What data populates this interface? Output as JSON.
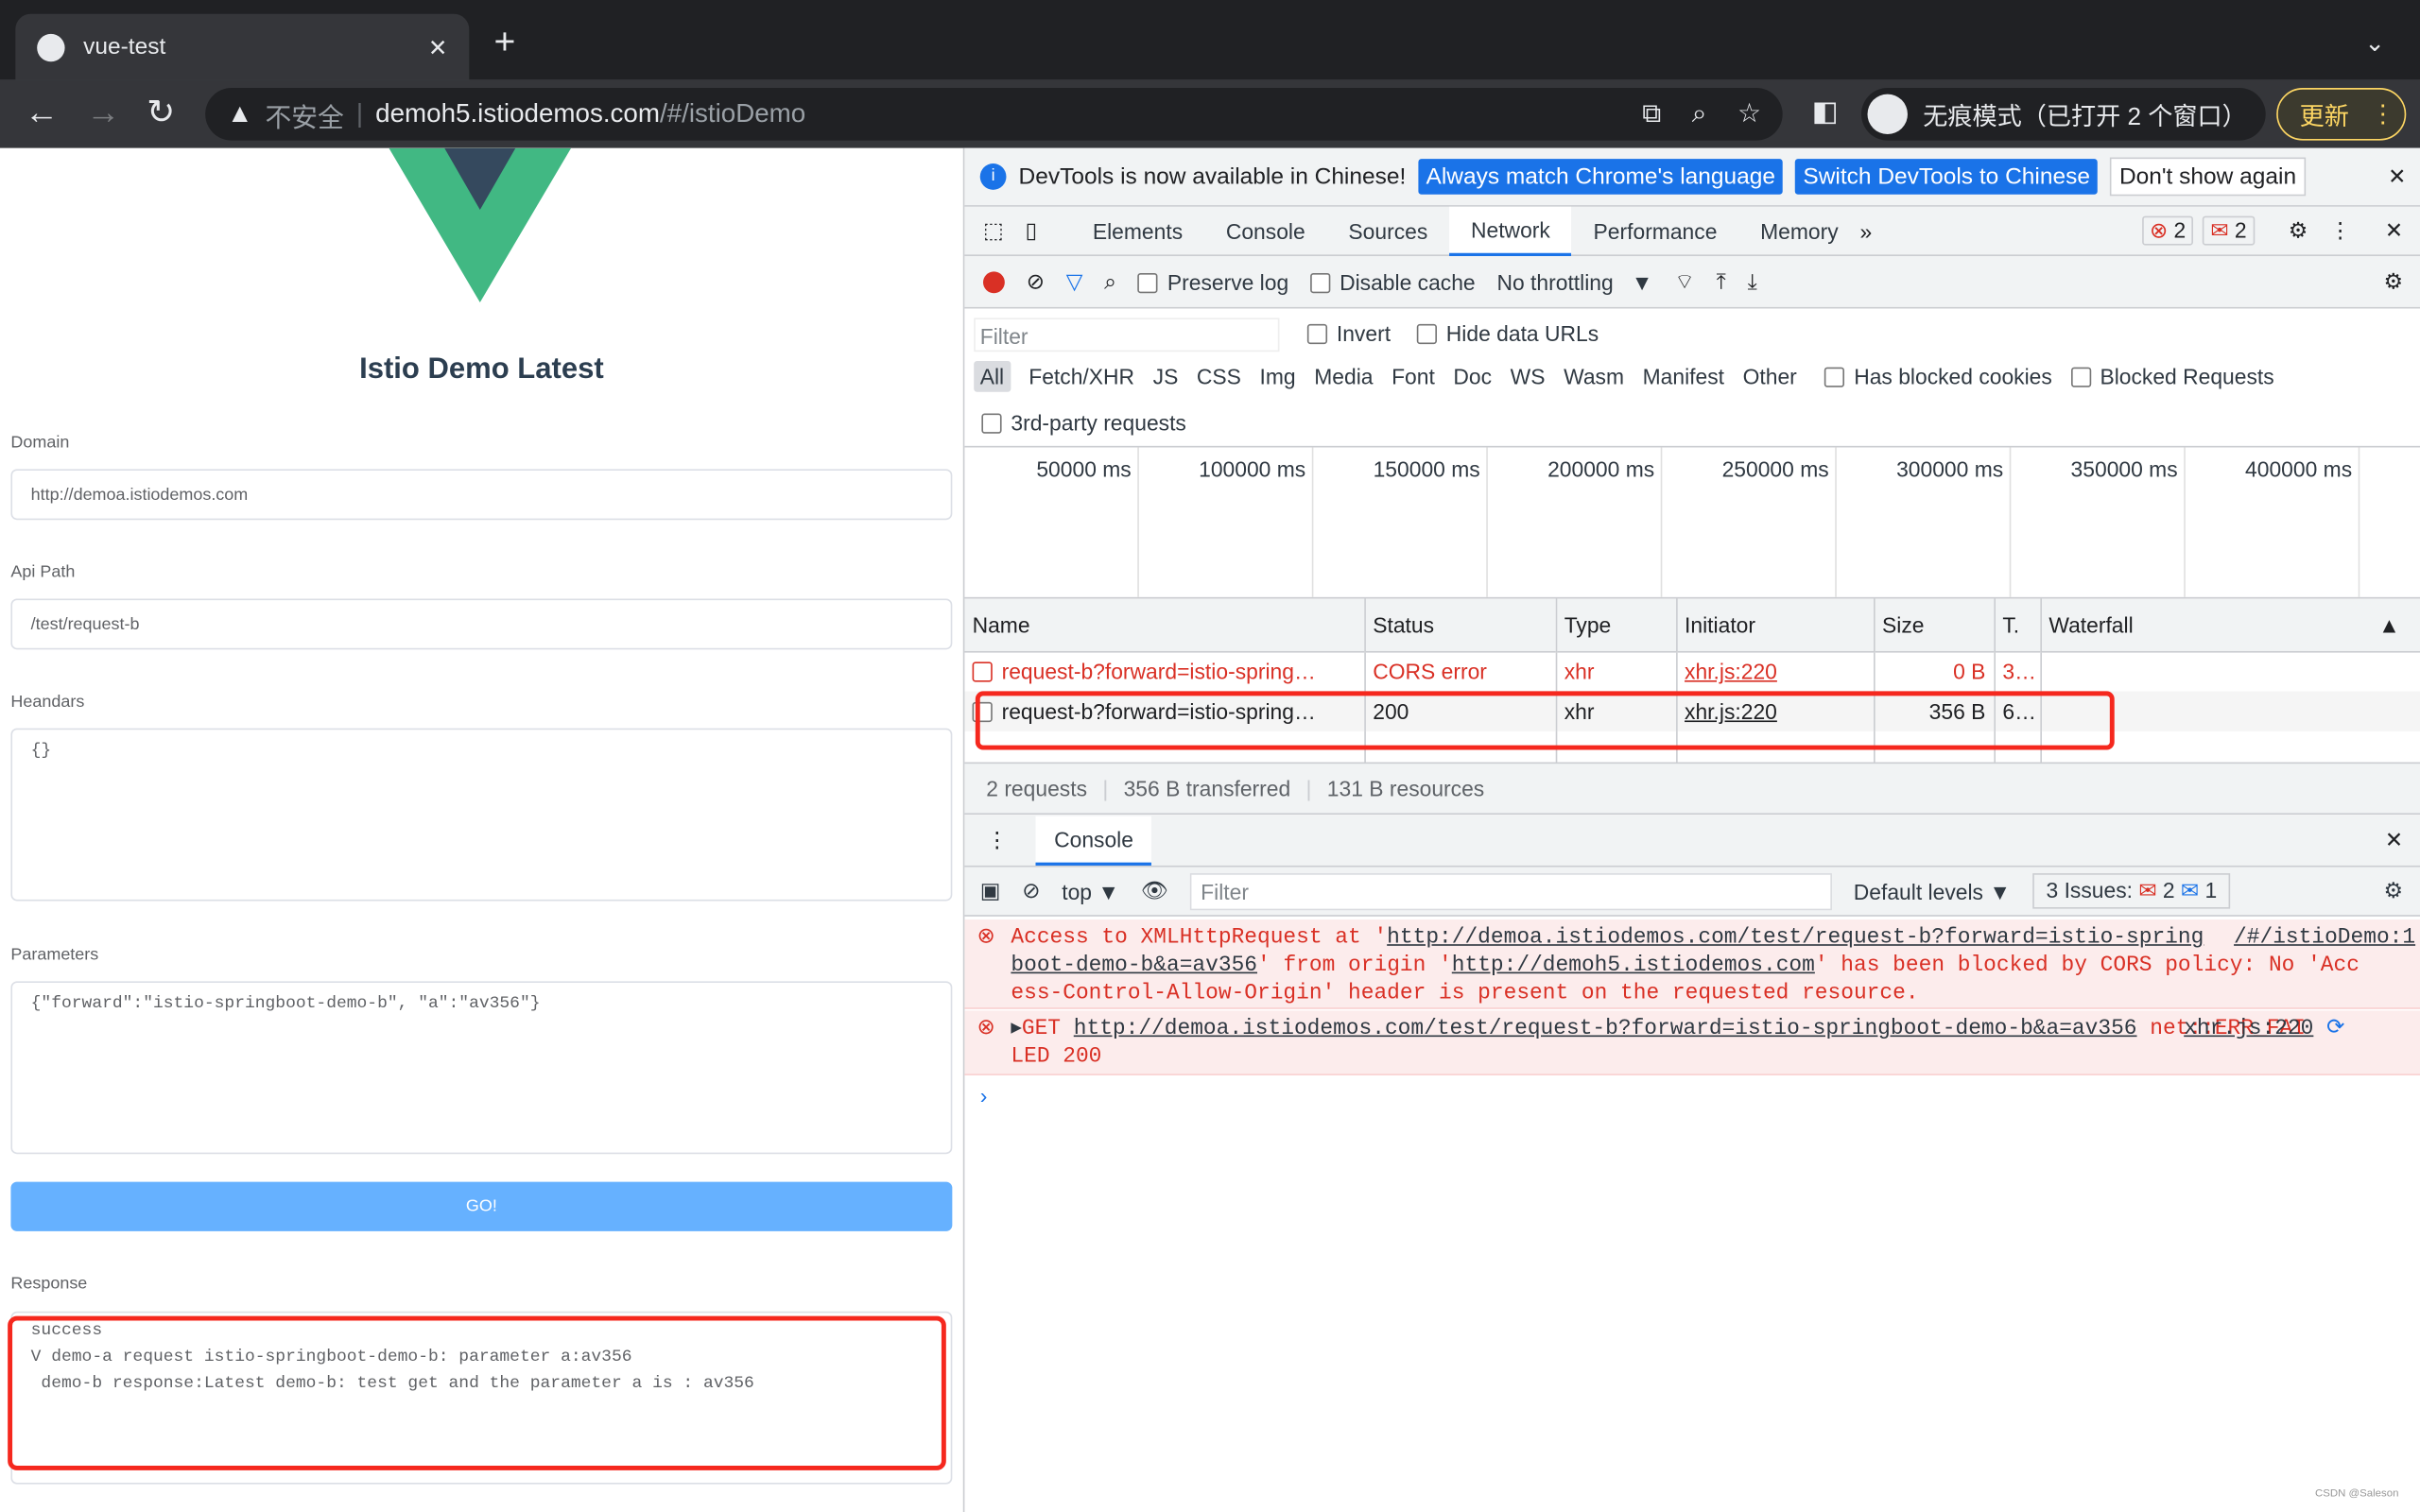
{
  "browser": {
    "tab_title": "vue-test",
    "security": "不安全",
    "url_host": "demoh5.istiodemos.com",
    "url_path": "/#/istioDemo",
    "incognito": "无痕模式（已打开 2 个窗口）",
    "update": "更新"
  },
  "app": {
    "title": "Istio Demo Latest",
    "domain_label": "Domain",
    "domain_value": "http://demoa.istiodemos.com",
    "path_label": "Api Path",
    "path_value": "/test/request-b",
    "headers_label": "Heandars",
    "headers_value": "{}",
    "params_label": "Parameters",
    "params_value": "{\"forward\":\"istio-springboot-demo-b\", \"a\":\"av356\"}",
    "go": "GO!",
    "response_label": "Response",
    "response_lines": [
      "success",
      "V demo-a request istio-springboot-demo-b: parameter a:av356",
      " demo-b response:Latest demo-b: test get and the parameter a is : av356"
    ]
  },
  "devtools": {
    "banner": {
      "text": "DevTools is now available in Chinese!",
      "match": "Always match Chrome's language",
      "switch": "Switch DevTools to Chinese",
      "dont": "Don't show again"
    },
    "tabs": [
      "Elements",
      "Console",
      "Sources",
      "Network",
      "Performance",
      "Memory"
    ],
    "active_tab": "Network",
    "errors": "2",
    "warnings": "2",
    "toolbar": {
      "preserve": "Preserve log",
      "cache": "Disable cache",
      "throttle": "No throttling"
    },
    "filter": {
      "placeholder": "Filter",
      "invert": "Invert",
      "hide": "Hide data URLs"
    },
    "types": [
      "All",
      "Fetch/XHR",
      "JS",
      "CSS",
      "Img",
      "Media",
      "Font",
      "Doc",
      "WS",
      "Wasm",
      "Manifest",
      "Other"
    ],
    "blocked_cookies": "Has blocked cookies",
    "blocked_req": "Blocked Requests",
    "third": "3rd-party requests",
    "timeline": [
      "50000 ms",
      "100000 ms",
      "150000 ms",
      "200000 ms",
      "250000 ms",
      "300000 ms",
      "350000 ms",
      "400000 ms"
    ],
    "columns": [
      "Name",
      "Status",
      "Type",
      "Initiator",
      "Size",
      "T.",
      "Waterfall"
    ],
    "rows": [
      {
        "name": "request-b?forward=istio-spring…",
        "status": "CORS error",
        "type": "xhr",
        "initiator": "xhr.js:220",
        "size": "0 B",
        "time": "3…"
      },
      {
        "name": "request-b?forward=istio-spring…",
        "status": "200",
        "type": "xhr",
        "initiator": "xhr.js:220",
        "size": "356 B",
        "time": "6…"
      }
    ],
    "summary": [
      "2 requests",
      "356 B transferred",
      "131 B resources"
    ],
    "console": {
      "title": "Console",
      "context": "top",
      "filter": "Filter",
      "levels": "Default levels",
      "issues": "3 Issues:",
      "issues_err": "2",
      "issues_info": "1",
      "msg1_a": "Access to XMLHttpRequest at '",
      "msg1_url": "http://demoa.istiodemos.com/test/request-b?forward=istio-springboot-demo-b&a=av356",
      "msg1_b": "' from origin '",
      "msg1_origin": "http://demoh5.istiodemos.com",
      "msg1_c": "' has been blocked by CORS policy: No 'Access-Control-Allow-Origin' header is present on the requested resource.",
      "msg1_src": "/#/istioDemo:1",
      "msg2_method": "GET",
      "msg2_url": "http://demoa.istiodemos.com/test/request-b?forward=istio-springboot-demo-b&a=av356",
      "msg2_rest": " net::ERR_FAILED 200",
      "msg2_src": "xhr.js:220"
    }
  },
  "watermark": "CSDN @Saleson"
}
